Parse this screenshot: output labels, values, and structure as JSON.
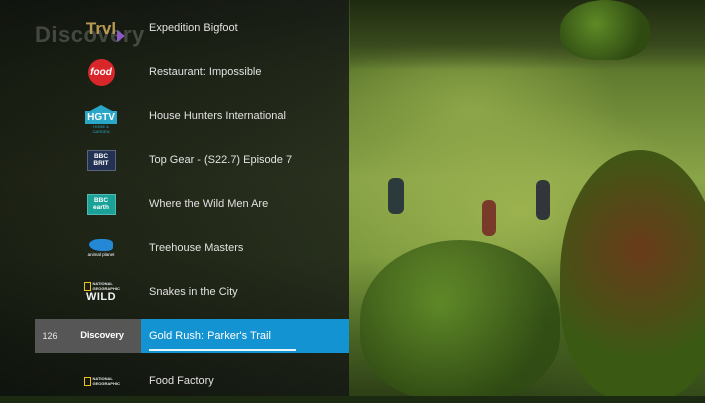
{
  "background": {
    "watermark": "Discovery"
  },
  "guide": {
    "rows": [
      {
        "logo_text": "Trvl",
        "logo_icon": "travel-channel-logo",
        "title": "Expedition Bigfoot"
      },
      {
        "logo_text": "food",
        "logo_icon": "food-network-logo",
        "title": "Restaurant: Impossible"
      },
      {
        "logo_text": "HGTV",
        "logo_sub": "HOME & GARDEN",
        "logo_icon": "hgtv-logo",
        "title": "House Hunters International"
      },
      {
        "logo_text": "BBC",
        "logo_sub": "BRIT",
        "logo_icon": "bbc-brit-logo",
        "title": "Top Gear - (S22.7) Episode 7"
      },
      {
        "logo_text": "BBC",
        "logo_sub": "earth",
        "logo_icon": "bbc-earth-logo",
        "title": "Where the Wild Men Are"
      },
      {
        "logo_text": "animal planet",
        "logo_icon": "animal-planet-logo",
        "title": "Treehouse Masters"
      },
      {
        "logo_text": "NATIONAL GEOGRAPHIC",
        "logo_sub": "WILD",
        "logo_icon": "nat-geo-wild-logo",
        "title": "Snakes in the City"
      },
      {
        "channel_number": "126",
        "logo_text": "Discovery",
        "logo_icon": "discovery-logo",
        "title": "Gold Rush: Parker's Trail",
        "selected": true
      },
      {
        "logo_text": "NATIONAL GEOGRAPHIC",
        "logo_icon": "nat-geo-logo",
        "title": "Food Factory"
      }
    ]
  },
  "colors": {
    "selection_blue": "#1493d3",
    "channel_cell_grey": "#5f5f5f"
  }
}
